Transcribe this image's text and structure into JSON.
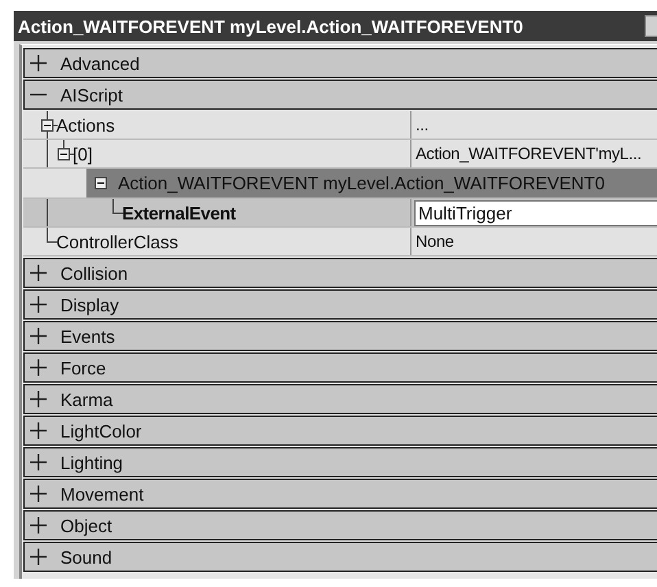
{
  "window": {
    "title": "Action_WAITFOREVENT myLevel.Action_WAITFOREVENT0"
  },
  "categories": [
    {
      "label": "Advanced",
      "expanded": false
    },
    {
      "label": "AIScript",
      "expanded": true,
      "properties": [
        {
          "name": "Actions",
          "value": "...",
          "expanded": true,
          "children": [
            {
              "name": "[0]",
              "value": "Action_WAITFOREVENT'myL...",
              "expanded": true,
              "object": {
                "title": "Action_WAITFOREVENT myLevel.Action_WAITFOREVENT0",
                "expanded": true,
                "properties": [
                  {
                    "name": "ExternalEvent",
                    "value": "MultiTrigger",
                    "editing": true
                  }
                ]
              }
            }
          ]
        },
        {
          "name": "ControllerClass",
          "value": "None",
          "editing": false
        }
      ]
    },
    {
      "label": "Collision",
      "expanded": false
    },
    {
      "label": "Display",
      "expanded": false
    },
    {
      "label": "Events",
      "expanded": false
    },
    {
      "label": "Force",
      "expanded": false
    },
    {
      "label": "Karma",
      "expanded": false
    },
    {
      "label": "LightColor",
      "expanded": false
    },
    {
      "label": "Lighting",
      "expanded": false
    },
    {
      "label": "Movement",
      "expanded": false
    },
    {
      "label": "Object",
      "expanded": false
    },
    {
      "label": "Sound",
      "expanded": false
    }
  ]
}
